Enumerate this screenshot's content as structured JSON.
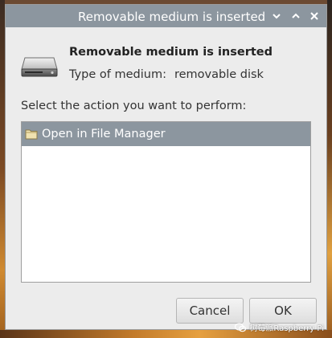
{
  "window": {
    "title": "Removable medium is inserted"
  },
  "dialog": {
    "heading": "Removable medium is inserted",
    "medium_label": "Type of medium:",
    "medium_value": "removable disk",
    "prompt": "Select the action you want to perform:",
    "actions": [
      {
        "label": "Open in File Manager",
        "icon": "folder-icon",
        "selected": true
      }
    ],
    "cancel_label": "Cancel",
    "ok_label": "OK"
  },
  "watermark": {
    "text": "树莓派Raspberry Pi"
  },
  "colors": {
    "titlebar": "#8c969f",
    "selection": "#8c969f",
    "window_bg": "#ececec"
  }
}
